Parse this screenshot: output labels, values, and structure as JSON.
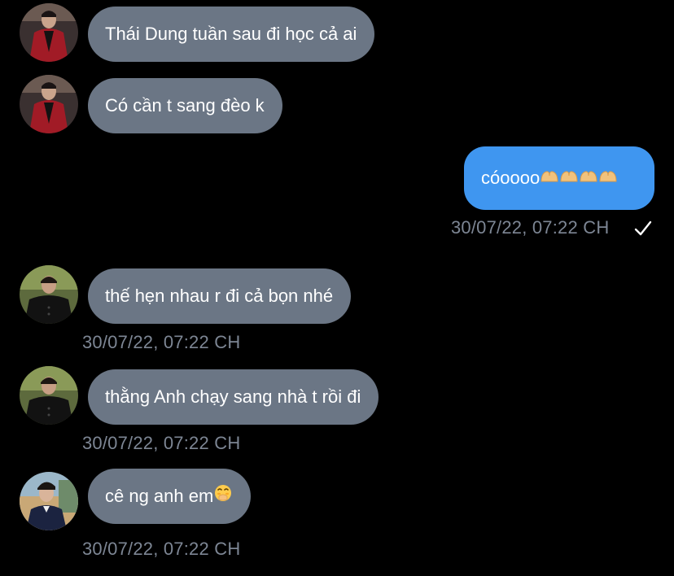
{
  "messages": [
    {
      "text": "Thái Dung tuần sau đi học cả ai"
    },
    {
      "text": "Có cần t sang đèo k"
    },
    {
      "text": "cóoooo",
      "timestamp": "30/07/22, 07:22 CH",
      "emoji": "heart-hands-emoji",
      "emoji_count": 4
    },
    {
      "text": "thế hẹn nhau r đi cả bọn nhé",
      "timestamp": "30/07/22, 07:22 CH"
    },
    {
      "text": "thằng Anh chạy sang nhà t rồi đi",
      "timestamp": "30/07/22, 07:22 CH"
    },
    {
      "text": "cê ng anh em",
      "timestamp": "30/07/22, 07:22 CH",
      "emoji": "face-with-hand-over-mouth-emoji"
    }
  ],
  "colors": {
    "background": "#000000",
    "incoming_bubble": "#6b7685",
    "outgoing_bubble": "#3f96f0",
    "timestamp": "#7d8694"
  }
}
